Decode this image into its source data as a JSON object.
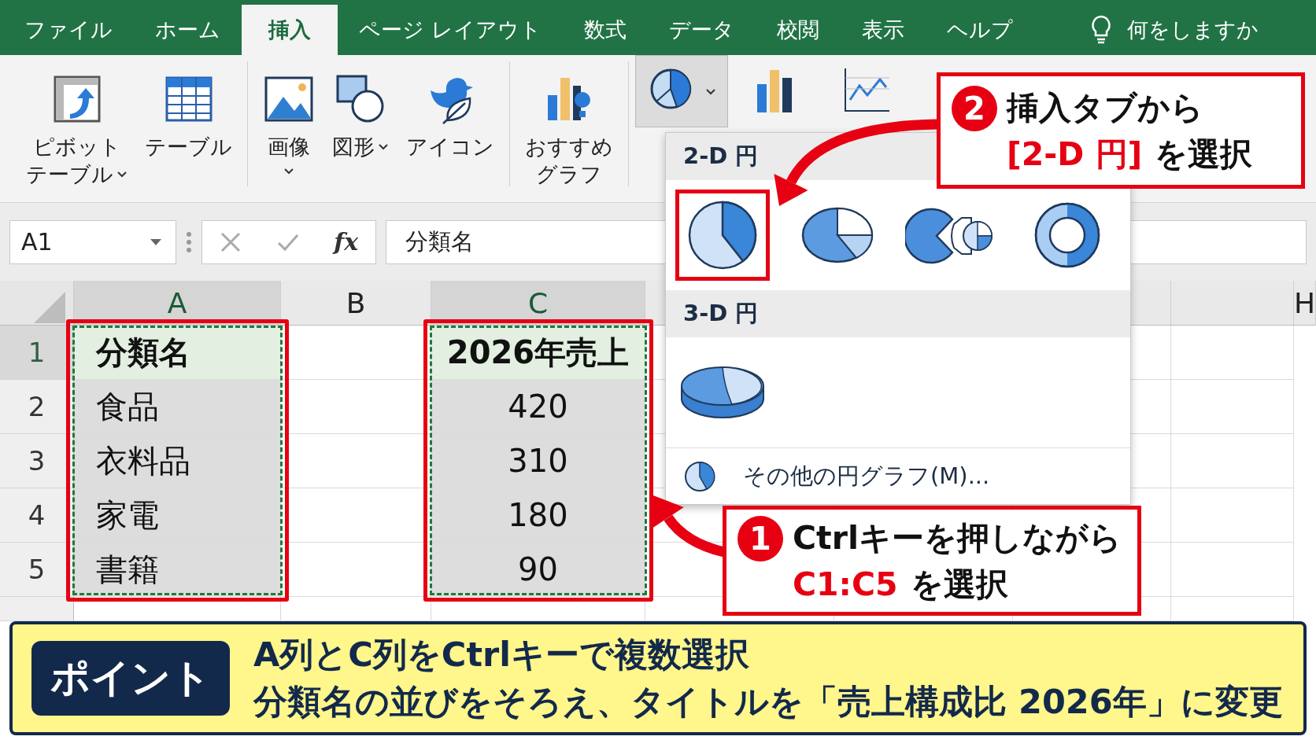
{
  "tabs": [
    {
      "label": "ファイル",
      "selected": false
    },
    {
      "label": "ホーム",
      "selected": false
    },
    {
      "label": "挿入",
      "selected": true
    },
    {
      "label": "ページ レイアウト",
      "selected": false
    },
    {
      "label": "数式",
      "selected": false
    },
    {
      "label": "データ",
      "selected": false
    },
    {
      "label": "校閲",
      "selected": false
    },
    {
      "label": "表示",
      "selected": false
    },
    {
      "label": "ヘルプ",
      "selected": false
    }
  ],
  "tell_me": "何をしますか",
  "ribbon": {
    "groups": [
      {
        "buttons": [
          {
            "kind": "pivot",
            "lines": [
              "ピボット",
              "テーブル"
            ],
            "dropdown": true,
            "pressed": false
          },
          {
            "kind": "table",
            "lines": [
              "テーブル"
            ],
            "dropdown": false,
            "pressed": false
          }
        ]
      },
      {
        "buttons": [
          {
            "kind": "picture",
            "lines": [
              "画像"
            ],
            "dropdown": true,
            "pressed": false
          },
          {
            "kind": "shapes",
            "lines": [
              "図形"
            ],
            "dropdown": true,
            "pressed": false
          },
          {
            "kind": "icons",
            "lines": [
              "アイコン"
            ],
            "dropdown": false,
            "pressed": false
          }
        ]
      },
      {
        "buttons": [
          {
            "kind": "recommended",
            "lines": [
              "おすすめ",
              "グラフ"
            ],
            "dropdown": false,
            "pressed": false
          }
        ]
      },
      {
        "buttons": [
          {
            "kind": "pie",
            "dropdown": true,
            "pressed": true
          },
          {
            "kind": "bar",
            "dropdown": false,
            "pressed": false
          },
          {
            "kind": "line",
            "dropdown": false,
            "pressed": false
          }
        ]
      }
    ]
  },
  "formula_bar": {
    "name_box": "A1",
    "function_label": "fx",
    "content": "分類名"
  },
  "sheet": {
    "columns": [
      {
        "label": "A",
        "selected": true,
        "cells": [
          "分類名",
          "食品",
          "衣料品",
          "家電",
          "書籍"
        ]
      },
      {
        "label": "B",
        "selected": false
      },
      {
        "label": "C",
        "selected": true,
        "cells": [
          "2026年売上",
          "420",
          "310",
          "180",
          "90"
        ]
      },
      {
        "label": "H",
        "selected": false
      }
    ],
    "rows": [
      {
        "header": "1",
        "kind": "heading",
        "selected": true
      },
      {
        "header": "2",
        "kind": "data",
        "selected": false
      },
      {
        "header": "3",
        "kind": "data",
        "selected": false
      },
      {
        "header": "4",
        "kind": "data",
        "selected": false
      },
      {
        "header": "5",
        "kind": "data",
        "selected": false
      }
    ]
  },
  "chart_menu": {
    "sections": [
      {
        "title": "2-D 円",
        "items": [
          {
            "kind": "pie",
            "selected": true
          },
          {
            "kind": "pie-oval",
            "selected": false
          },
          {
            "kind": "pie-of-pie",
            "selected": false
          },
          {
            "kind": "doughnut",
            "selected": false
          }
        ]
      },
      {
        "title": "3-D 円",
        "items": [
          {
            "kind": "pie-3d",
            "selected": false
          }
        ]
      }
    ],
    "more": "その他の円グラフ(M)..."
  },
  "callouts": [
    {
      "number": "2",
      "text": "挿入タブから",
      "accent": "[2-D 円]",
      "rest": "を選択"
    },
    {
      "number": "1",
      "text": "Ctrlキーを押しながら",
      "accent": "C1:C5",
      "rest": "を選択"
    }
  ],
  "point": {
    "badge": "ポイント",
    "lines": [
      "A列とC列をCtrlキーで複数選択",
      "分類名の並びをそろえ、タイトルを「売上構成比 2026年」に変更"
    ]
  }
}
